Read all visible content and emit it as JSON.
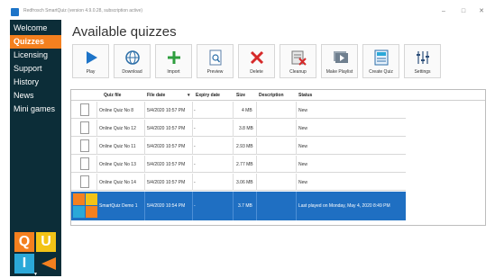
{
  "window": {
    "title": "Redfrosch SmartQuiz (version 4.9.0.28, subscription active)",
    "controls": {
      "minimize": "–",
      "maximize": "□",
      "close": "✕"
    }
  },
  "sidebar": {
    "items": [
      {
        "label": "Welcome",
        "active": false
      },
      {
        "label": "Quizzes",
        "active": true
      },
      {
        "label": "Licensing",
        "active": false
      },
      {
        "label": "Support",
        "active": false
      },
      {
        "label": "History",
        "active": false
      },
      {
        "label": "News",
        "active": false
      },
      {
        "label": "Mini games",
        "active": false
      }
    ],
    "logo": {
      "q": "Q",
      "u": "U",
      "i": "I",
      "z": "Z"
    }
  },
  "page": {
    "title": "Available quizzes"
  },
  "toolbar": {
    "buttons": [
      {
        "label": "Play",
        "icon": "play-icon"
      },
      {
        "label": "Download",
        "icon": "globe-icon"
      },
      {
        "label": "Import",
        "icon": "plus-icon"
      },
      {
        "label": "Preview",
        "icon": "preview-icon"
      },
      {
        "label": "Delete",
        "icon": "delete-icon"
      },
      {
        "label": "Cleanup",
        "icon": "cleanup-icon"
      },
      {
        "label": "Make Playlist",
        "icon": "playlist-icon"
      },
      {
        "label": "Create Quiz",
        "icon": "create-quiz-icon"
      },
      {
        "label": "Settings",
        "icon": "sliders-icon"
      }
    ]
  },
  "table": {
    "columns": [
      "Quiz file",
      "File date",
      "Expiry date",
      "Size",
      "Description",
      "Status"
    ],
    "rows": [
      {
        "file": "Online Quiz No 8",
        "date": "5/4/2020 10:57 PM",
        "expiry": "-",
        "size": "4 MB",
        "description": "",
        "status": "New"
      },
      {
        "file": "Online Quiz No 12",
        "date": "5/4/2020 10:57 PM",
        "expiry": "-",
        "size": "3.8 MB",
        "description": "",
        "status": "New"
      },
      {
        "file": "Online Quiz No 11",
        "date": "5/4/2020 10:57 PM",
        "expiry": "-",
        "size": "2.93 MB",
        "description": "",
        "status": "New"
      },
      {
        "file": "Online Quiz No 13",
        "date": "5/4/2020 10:57 PM",
        "expiry": "-",
        "size": "2.77 MB",
        "description": "",
        "status": "New"
      },
      {
        "file": "Online Quiz No 14",
        "date": "5/4/2020 10:57 PM",
        "expiry": "-",
        "size": "3.06 MB",
        "description": "",
        "status": "New"
      },
      {
        "file": "SmartQuiz Demo 1",
        "date": "5/4/2020 10:54 PM",
        "expiry": "-",
        "size": "3.7 MB",
        "description": "",
        "status": "Last played on Monday, May 4, 2020 8:49 PM"
      }
    ]
  },
  "colors": {
    "sidebar_bg": "#0c2d38",
    "accent": "#f4801f",
    "selection": "#1f6fc2",
    "play": "#1d74c8",
    "import": "#2e9e3e",
    "delete": "#d62a2a"
  }
}
